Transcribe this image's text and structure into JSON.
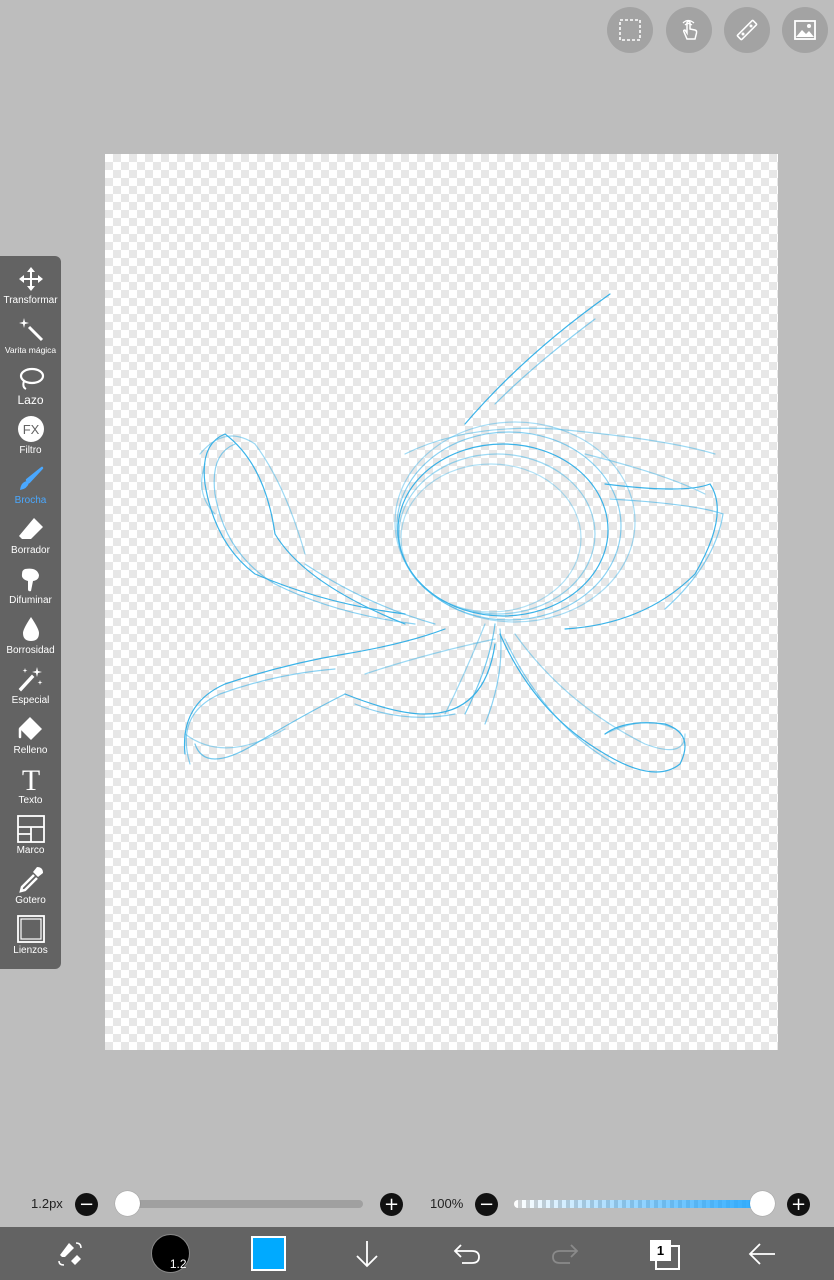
{
  "top_toolbar": {
    "buttons": [
      {
        "name": "selection",
        "icon": "dashed-selection-icon"
      },
      {
        "name": "touch",
        "icon": "hand-touch-icon"
      },
      {
        "name": "ruler",
        "icon": "ruler-icon"
      },
      {
        "name": "image",
        "icon": "image-icon"
      }
    ]
  },
  "tools": [
    {
      "label": "Transformar",
      "icon": "move-arrows-icon"
    },
    {
      "label": "Varita mágica",
      "icon": "magic-wand-icon"
    },
    {
      "label": "Lazo",
      "icon": "lasso-icon"
    },
    {
      "label": "Filtro",
      "icon": "fx-icon",
      "glyph": "FX"
    },
    {
      "label": "Brocha",
      "icon": "brush-icon",
      "active": true
    },
    {
      "label": "Borrador",
      "icon": "eraser-icon"
    },
    {
      "label": "Difuminar",
      "icon": "smudge-icon"
    },
    {
      "label": "Borrosidad",
      "icon": "blur-drop-icon"
    },
    {
      "label": "Especial",
      "icon": "special-brush-icon"
    },
    {
      "label": "Relleno",
      "icon": "bucket-fill-icon"
    },
    {
      "label": "Texto",
      "icon": "text-icon",
      "glyph": "T"
    },
    {
      "label": "Marco",
      "icon": "frame-icon"
    },
    {
      "label": "Gotero",
      "icon": "eyedropper-icon"
    },
    {
      "label": "Lienzos",
      "icon": "canvas-icon"
    }
  ],
  "brush_slider": {
    "label": "1.2px",
    "minus": "−",
    "plus": "+",
    "value_fraction": 0.0
  },
  "opacity_slider": {
    "label": "100%",
    "minus": "−",
    "plus": "+",
    "value_fraction": 1.0
  },
  "bottom_bar": {
    "brush_size_text": "1.2",
    "color": "#00aaff",
    "layer_count": "1",
    "redo_enabled": false
  },
  "colors": {
    "stroke": "#1aa7e6",
    "panel": "#636363",
    "background": "#bdbdbd",
    "active_tool": "#4aa8ff"
  }
}
